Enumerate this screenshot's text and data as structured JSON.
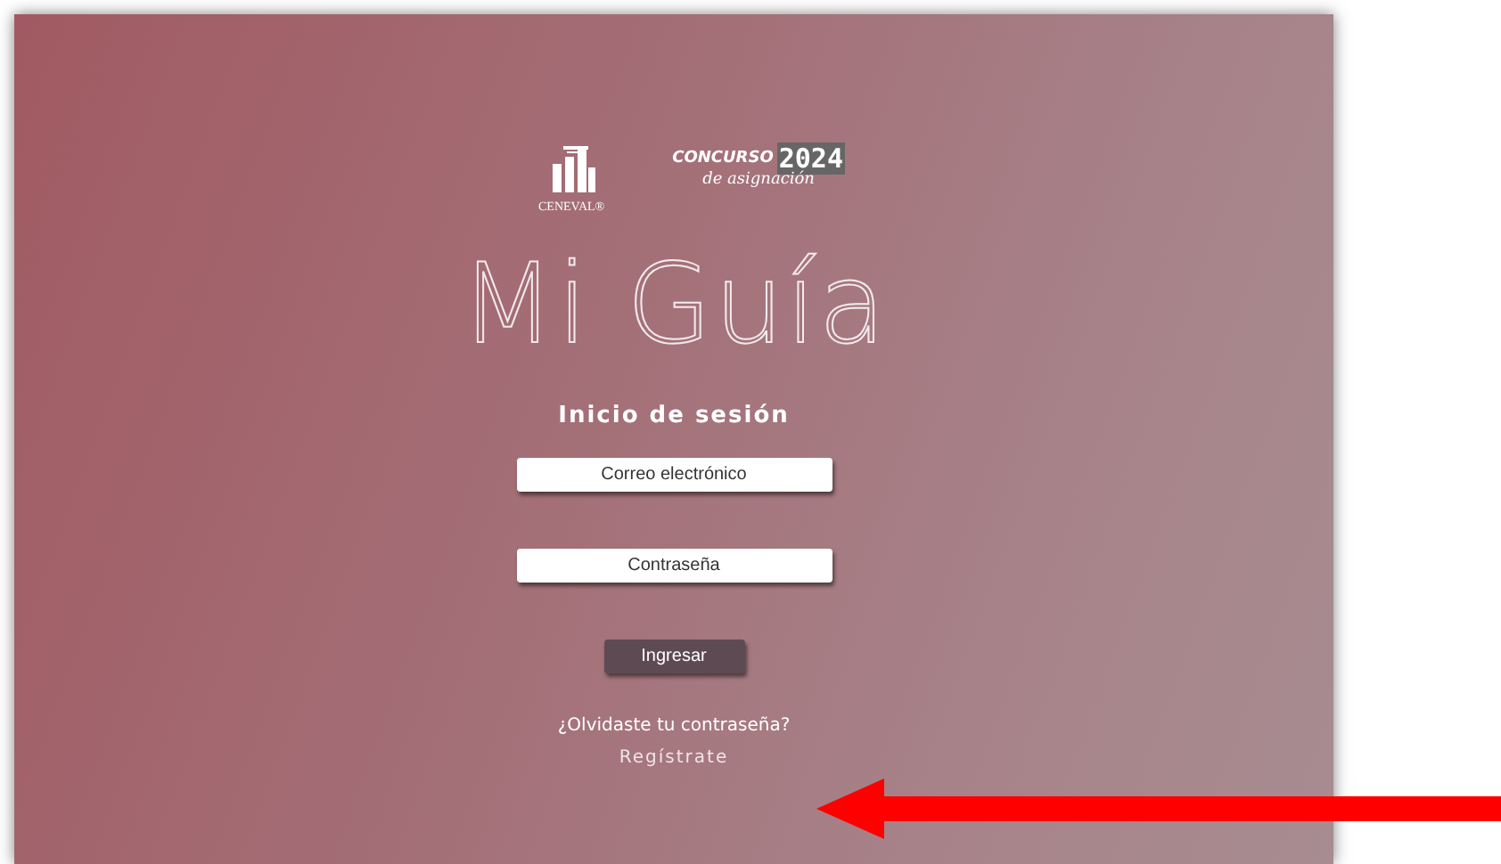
{
  "logos": {
    "ceneval": "CENEVAL®",
    "concurso": "CONCURSO",
    "year": "2024",
    "subtitle": "de asignación"
  },
  "title": "Mi Guía",
  "login": {
    "heading": "Inicio de sesión",
    "fields": [
      {
        "placeholder": "Correo electrónico"
      },
      {
        "placeholder": "Contraseña"
      }
    ],
    "submit": "Ingresar",
    "forgot_link": "¿Olvidaste tu contraseña?",
    "register_link": "Regístrate"
  }
}
